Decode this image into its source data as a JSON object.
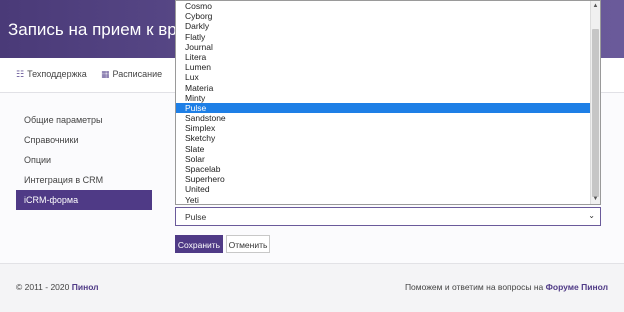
{
  "header": {
    "title": "Запись на прием к врачу в"
  },
  "topnav": {
    "items": [
      {
        "label": "Техподдержка",
        "icon": "user-icon"
      },
      {
        "label": "Расписание",
        "icon": "calendar-icon"
      }
    ]
  },
  "sidebar": {
    "items": [
      {
        "label": "Общие параметры"
      },
      {
        "label": "Справочники"
      },
      {
        "label": "Опции"
      },
      {
        "label": "Интеграция в CRM"
      },
      {
        "label": "iCRM-форма",
        "active": true
      }
    ]
  },
  "theme_select": {
    "value": "Pulse",
    "options": [
      "Cosmo",
      "Cyborg",
      "Darkly",
      "Flatly",
      "Journal",
      "Litera",
      "Lumen",
      "Lux",
      "Materia",
      "Minty",
      "Pulse",
      "Sandstone",
      "Simplex",
      "Sketchy",
      "Slate",
      "Solar",
      "Spacelab",
      "Superhero",
      "United",
      "Yeti"
    ],
    "selected_index": 10
  },
  "buttons": {
    "save": "Сохранить",
    "cancel": "Отменить"
  },
  "footer": {
    "copyright": "© 2011 - 2020 ",
    "brand": "Пинол",
    "help_text": "Поможем и ответим на вопросы на ",
    "help_link": "Форуме Пинол"
  },
  "colors": {
    "accent": "#4f3a86",
    "header": "#5b4b8a",
    "selection": "#1e7fe6"
  }
}
